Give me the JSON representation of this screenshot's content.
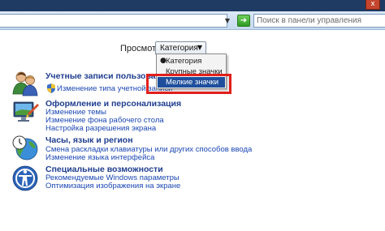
{
  "toolbar": {
    "close_glyph": "x",
    "address_dropdown_glyph": "▼",
    "refresh_glyph": "➜",
    "search_placeholder": "Поиск в панели управления"
  },
  "view": {
    "label": "Просмотр:",
    "selected": "Категория",
    "arrow": "▼",
    "options": [
      "Категория",
      "Крупные значки",
      "Мелкие значки"
    ],
    "bullet": "●"
  },
  "colors": {
    "highlight_border": "#e0201c",
    "link": "#1b47b3",
    "title": "#1e3d8f",
    "selected_item": "#1f4f9c"
  },
  "categories": [
    {
      "icon": "users-icon",
      "title": "Учетные записи пользователей",
      "links": [
        "Изменение типа учетной записи"
      ]
    },
    {
      "icon": "appearance-icon",
      "title": "Оформление и персонализация",
      "links": [
        "Изменение темы",
        "Изменение фона рабочего стола",
        "Настройка разрешения экрана"
      ]
    },
    {
      "icon": "clock-globe-icon",
      "title": "Часы, язык и регион",
      "links": [
        "Смена раскладки клавиатуры или других способов ввода",
        "Изменение языка интерфейса"
      ]
    },
    {
      "icon": "accessibility-icon",
      "title": "Специальные возможности",
      "links": [
        "Рекомендуемые Windows параметры",
        "Оптимизация изображения на экране"
      ]
    }
  ]
}
